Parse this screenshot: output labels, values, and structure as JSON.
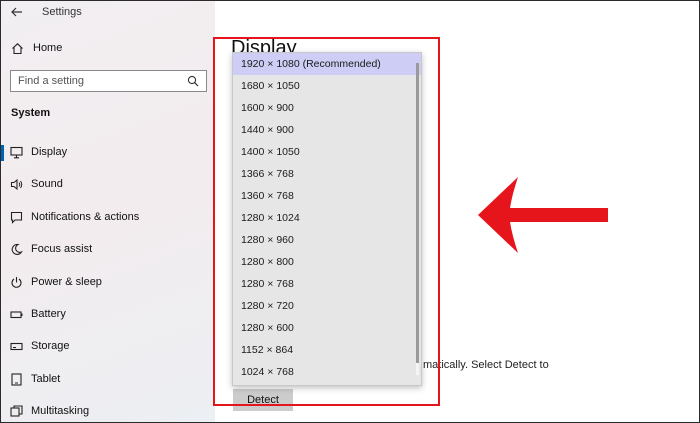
{
  "app": {
    "title": "Settings"
  },
  "sidebar": {
    "home_label": "Home",
    "search_placeholder": "Find a setting",
    "section_title": "System",
    "items": [
      {
        "label": "Display",
        "icon": "monitor-icon",
        "active": true
      },
      {
        "label": "Sound",
        "icon": "speaker-icon"
      },
      {
        "label": "Notifications & actions",
        "icon": "notification-icon"
      },
      {
        "label": "Focus assist",
        "icon": "moon-icon"
      },
      {
        "label": "Power & sleep",
        "icon": "power-icon"
      },
      {
        "label": "Battery",
        "icon": "battery-icon"
      },
      {
        "label": "Storage",
        "icon": "storage-icon"
      },
      {
        "label": "Tablet",
        "icon": "tablet-icon"
      },
      {
        "label": "Multitasking",
        "icon": "multitasking-icon"
      }
    ]
  },
  "main": {
    "page_title": "Display",
    "text_fragment_top": "s",
    "text_fragment_bottom": "matically. Select Detect to",
    "detect_label": "Detect"
  },
  "resolution_dropdown": {
    "selected_index": 0,
    "options": [
      "1920 × 1080 (Recommended)",
      "1680 × 1050",
      "1600 × 900",
      "1440 × 900",
      "1400 × 1050",
      "1366 × 768",
      "1360 × 768",
      "1280 × 1024",
      "1280 × 960",
      "1280 × 800",
      "1280 × 768",
      "1280 × 720",
      "1280 × 600",
      "1152 × 864",
      "1024 × 768"
    ]
  },
  "colors": {
    "accent": "#0063b1",
    "annotation_red": "#e6141b",
    "selected_option": "#cdcdf5"
  }
}
